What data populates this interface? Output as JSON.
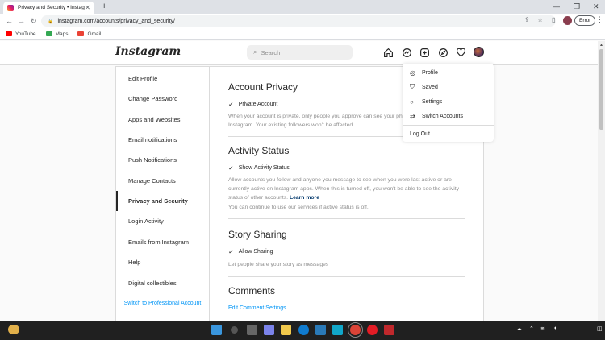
{
  "browser": {
    "tab_title": "Privacy and Security • Instagram",
    "url": "instagram.com/accounts/privacy_and_security/",
    "error_label": "Error",
    "bookmarks": [
      "YouTube",
      "Maps",
      "Gmail"
    ]
  },
  "header": {
    "logo": "Instagram",
    "search_placeholder": "Search"
  },
  "sidebar": {
    "items": [
      "Edit Profile",
      "Change Password",
      "Apps and Websites",
      "Email notifications",
      "Push Notifications",
      "Manage Contacts",
      "Privacy and Security",
      "Login Activity",
      "Emails from Instagram",
      "Help",
      "Digital collectibles"
    ],
    "active": "Privacy and Security",
    "switch_professional": "Switch to Professional Account"
  },
  "content": {
    "account_privacy": {
      "title": "Account Privacy",
      "checkbox": "Private Account",
      "desc": "When your account is private, only people you approve can see your photos and videos on Instagram. Your existing followers won't be affected."
    },
    "activity_status": {
      "title": "Activity Status",
      "checkbox": "Show Activity Status",
      "desc": "Allow accounts you follow and anyone you message to see when you were last active or are currently active on Instagram apps. When this is turned off, you won't be able to see the activity status of other accounts.",
      "learn_more": "Learn more",
      "desc2": "You can continue to use our services if active status is off."
    },
    "story_sharing": {
      "title": "Story Sharing",
      "checkbox": "Allow Sharing",
      "desc": "Let people share your story as messages"
    },
    "comments": {
      "title": "Comments",
      "link": "Edit Comment Settings"
    }
  },
  "dropdown": {
    "profile": "Profile",
    "saved": "Saved",
    "settings": "Settings",
    "switch_accounts": "Switch Accounts",
    "logout": "Log Out"
  }
}
